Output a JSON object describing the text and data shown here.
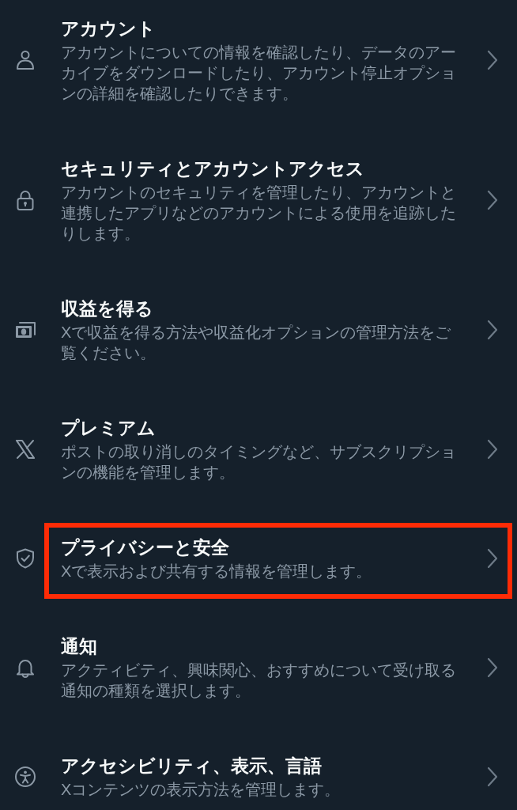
{
  "items": [
    {
      "kind": "account",
      "title": "アカウント",
      "description": "アカウントについての情報を確認したり、データのアーカイブをダウンロードしたり、アカウント停止オプションの詳細を確認したりできます。",
      "highlighted": false
    },
    {
      "kind": "security",
      "title": "セキュリティとアカウントアクセス",
      "description": "アカウントのセキュリティを管理したり、アカウントと連携したアプリなどのアカウントによる使用を追跡したりします。",
      "highlighted": false
    },
    {
      "kind": "monetization",
      "title": "収益を得る",
      "description": "Xで収益を得る方法や収益化オプションの管理方法をご覧ください。",
      "highlighted": false
    },
    {
      "kind": "premium",
      "title": "プレミアム",
      "description": "ポストの取り消しのタイミングなど、サブスクリプションの機能を管理します。",
      "highlighted": false
    },
    {
      "kind": "privacy",
      "title": "プライバシーと安全",
      "description": "Xで表示および共有する情報を管理します。",
      "highlighted": true
    },
    {
      "kind": "notifications",
      "title": "通知",
      "description": "アクティビティ、興味関心、おすすめについて受け取る通知の種類を選択します。",
      "highlighted": false
    },
    {
      "kind": "accessibility",
      "title": "アクセシビリティ、表示、言語",
      "description": "Xコンテンツの表示方法を管理します。",
      "highlighted": false
    }
  ]
}
